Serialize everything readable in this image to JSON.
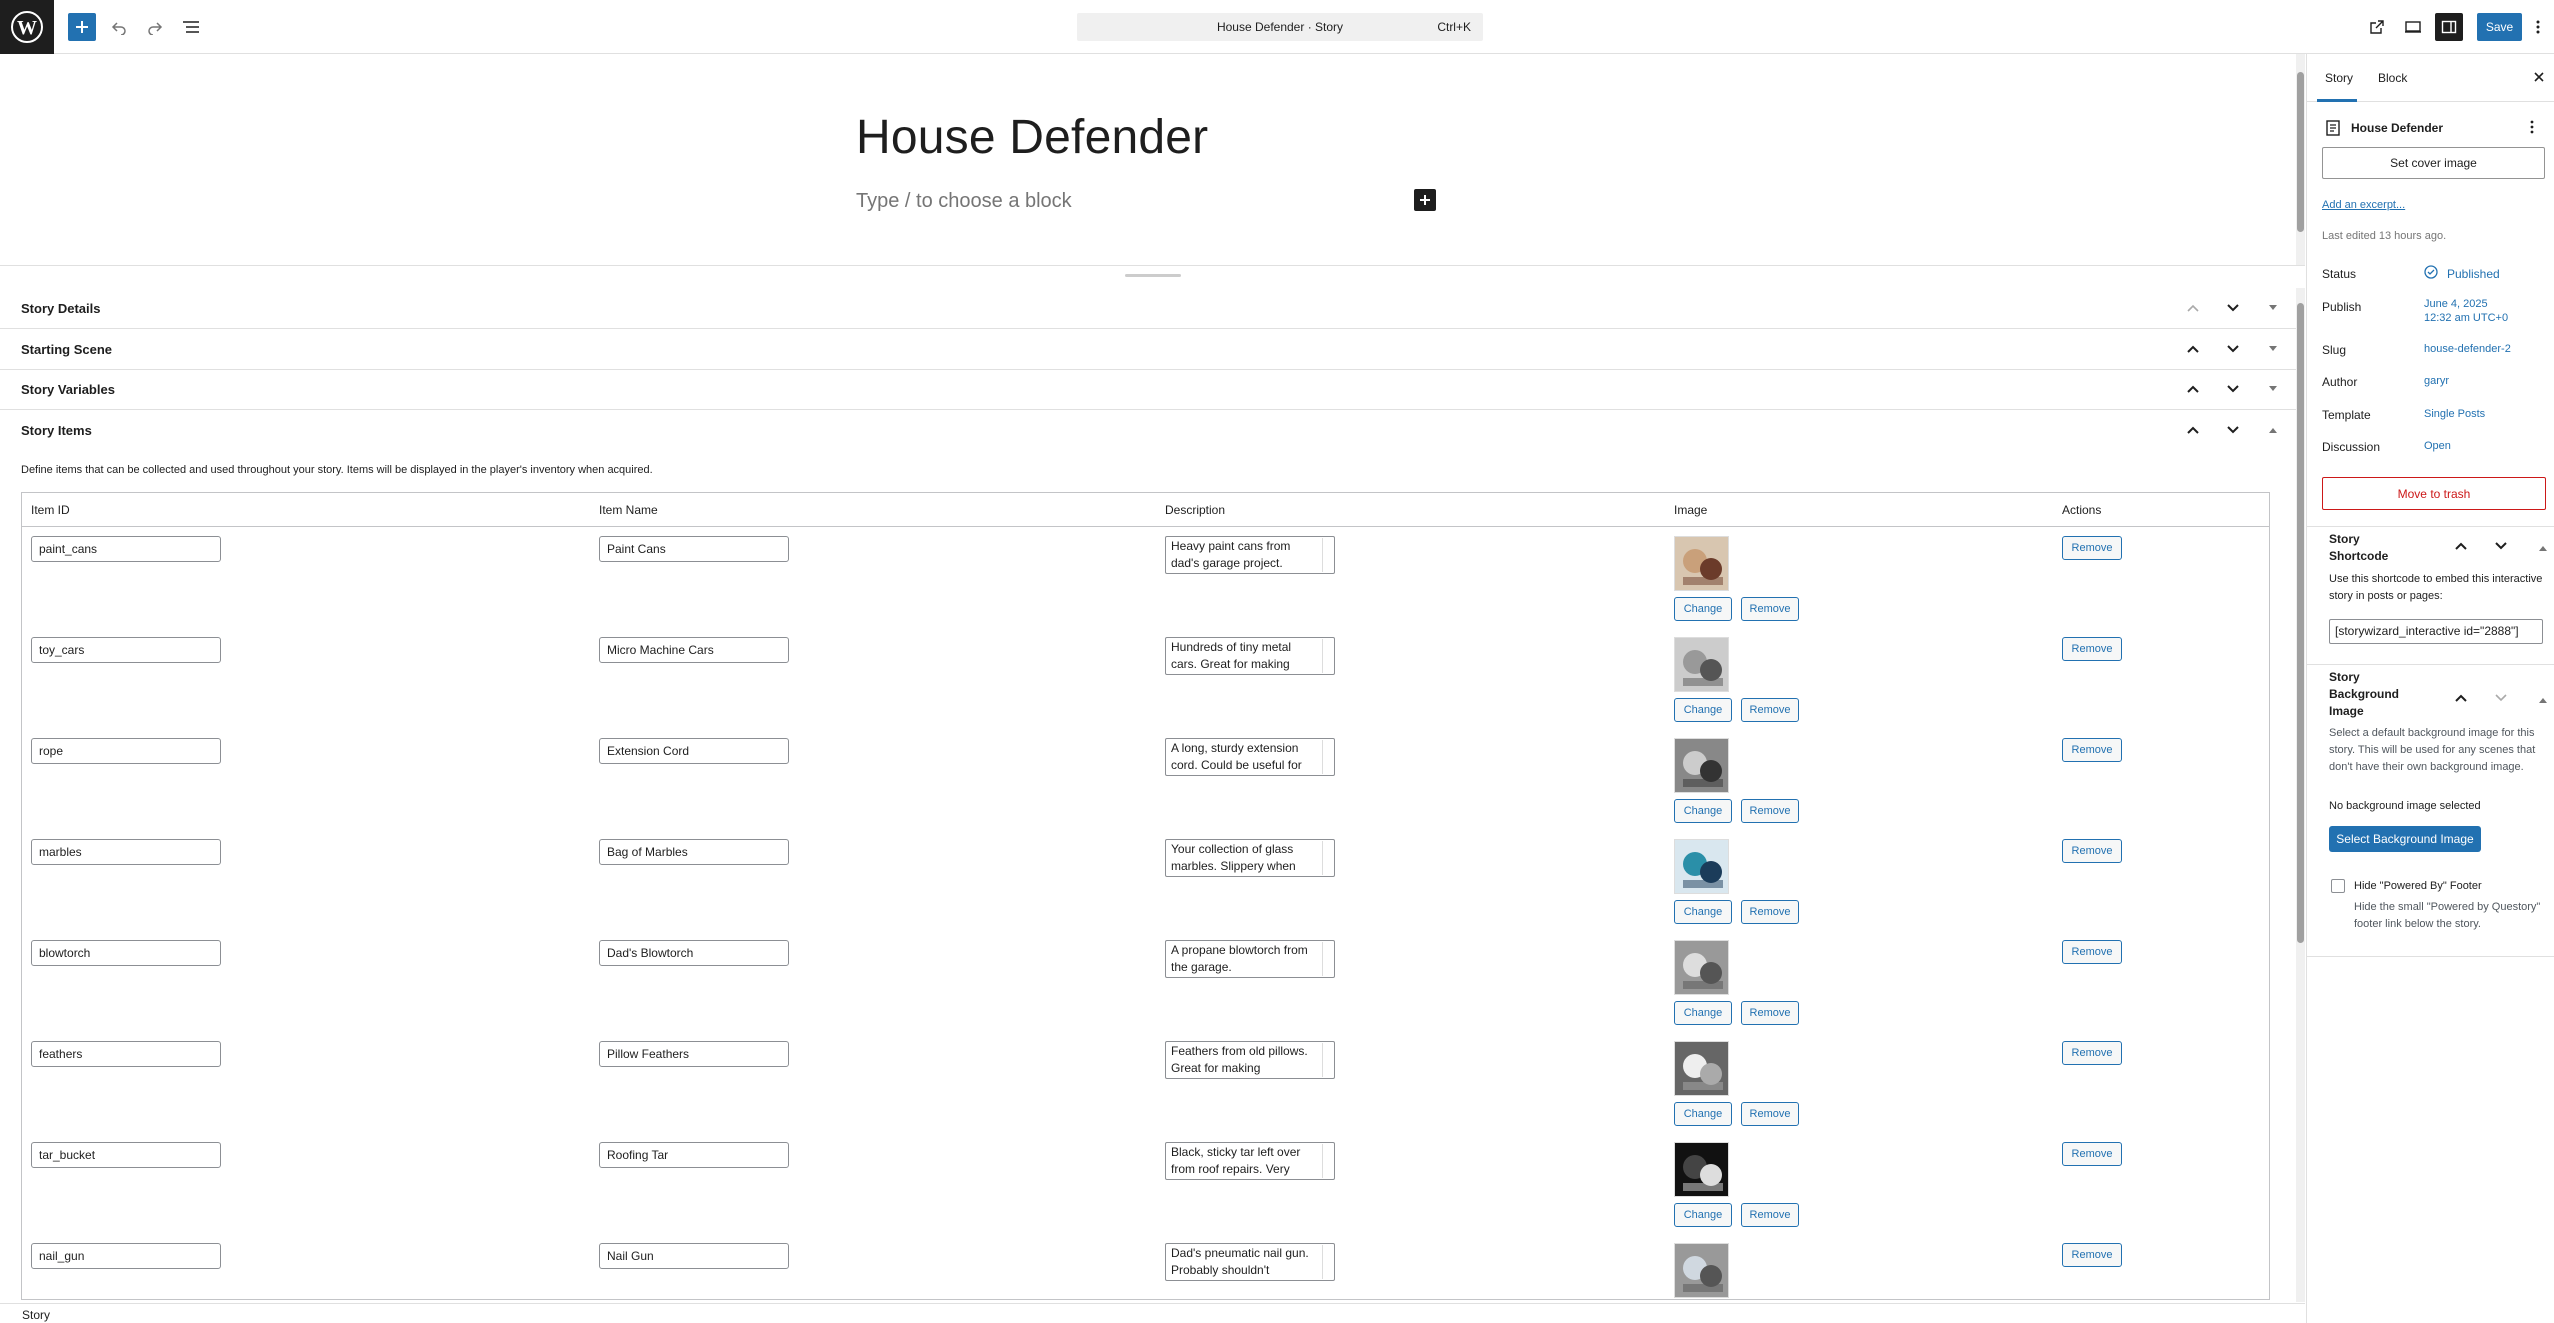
{
  "toolbar": {
    "command_title": "House Defender · Story",
    "command_shortcut": "Ctrl+K",
    "save_label": "Save"
  },
  "editor": {
    "title": "House Defender",
    "placeholder": "Type / to choose a block"
  },
  "metaboxes": [
    {
      "title": "Story Details"
    },
    {
      "title": "Starting Scene"
    },
    {
      "title": "Story Variables"
    },
    {
      "title": "Story Items"
    }
  ],
  "items": {
    "description": "Define items that can be collected and used throughout your story. Items will be displayed in the player's inventory when acquired.",
    "headers": [
      "Item ID",
      "Item Name",
      "Description",
      "Image",
      "Actions"
    ],
    "change_label": "Change",
    "remove_label": "Remove",
    "rows": [
      {
        "id": "paint_cans",
        "name": "Paint Cans",
        "desc": "Heavy paint cans from dad's garage project."
      },
      {
        "id": "toy_cars",
        "name": "Micro Machine Cars",
        "desc": "Hundreds of tiny metal cars. Great for making"
      },
      {
        "id": "rope",
        "name": "Extension Cord",
        "desc": "A long, sturdy extension cord. Could be useful for"
      },
      {
        "id": "marbles",
        "name": "Bag of Marbles",
        "desc": "Your collection of glass marbles. Slippery when"
      },
      {
        "id": "blowtorch",
        "name": "Dad's Blowtorch",
        "desc": "A propane blowtorch from the garage."
      },
      {
        "id": "feathers",
        "name": "Pillow Feathers",
        "desc": "Feathers from old pillows. Great for making"
      },
      {
        "id": "tar_bucket",
        "name": "Roofing Tar",
        "desc": "Black, sticky tar left over from roof repairs. Very"
      },
      {
        "id": "nail_gun",
        "name": "Nail Gun",
        "desc": "Dad's pneumatic nail gun. Probably shouldn't"
      }
    ]
  },
  "status_bar": {
    "label": "Story"
  },
  "sidebar": {
    "tabs": [
      "Story",
      "Block"
    ],
    "doc_title": "House Defender",
    "cover_label": "Set cover image",
    "excerpt_label": "Add an excerpt...",
    "last_edited": "Last edited 13 hours ago.",
    "status_label": "Status",
    "status_value": "Published",
    "publish_label": "Publish",
    "publish_date": "June 4, 2025",
    "publish_time": "12:32 am UTC+0",
    "slug_label": "Slug",
    "slug_value": "house-defender-2",
    "author_label": "Author",
    "author_value": "garyr",
    "template_label": "Template",
    "template_value": "Single Posts",
    "discussion_label": "Discussion",
    "discussion_value": "Open",
    "trash_label": "Move to trash",
    "shortcode_title_1": "Story",
    "shortcode_title_2": "Shortcode",
    "shortcode_help": "Use this shortcode to embed this interactive story in posts or pages:",
    "shortcode_value": "[storywizard_interactive id=\"2888\"]",
    "bg_title_1": "Story",
    "bg_title_2": "Background",
    "bg_title_3": "Image",
    "bg_help": "Select a default background image for this story. This will be used for any scenes that don't have their own background image.",
    "bg_none": "No background image selected",
    "bg_button": "Select Background Image",
    "footer_check_label": "Hide \"Powered By\" Footer",
    "footer_check_help": "Hide the small \"Powered by Questory\" footer link below the story."
  },
  "colors": {
    "accent": "#2271b1",
    "danger": "#cc1818",
    "published": "#2271b1"
  }
}
